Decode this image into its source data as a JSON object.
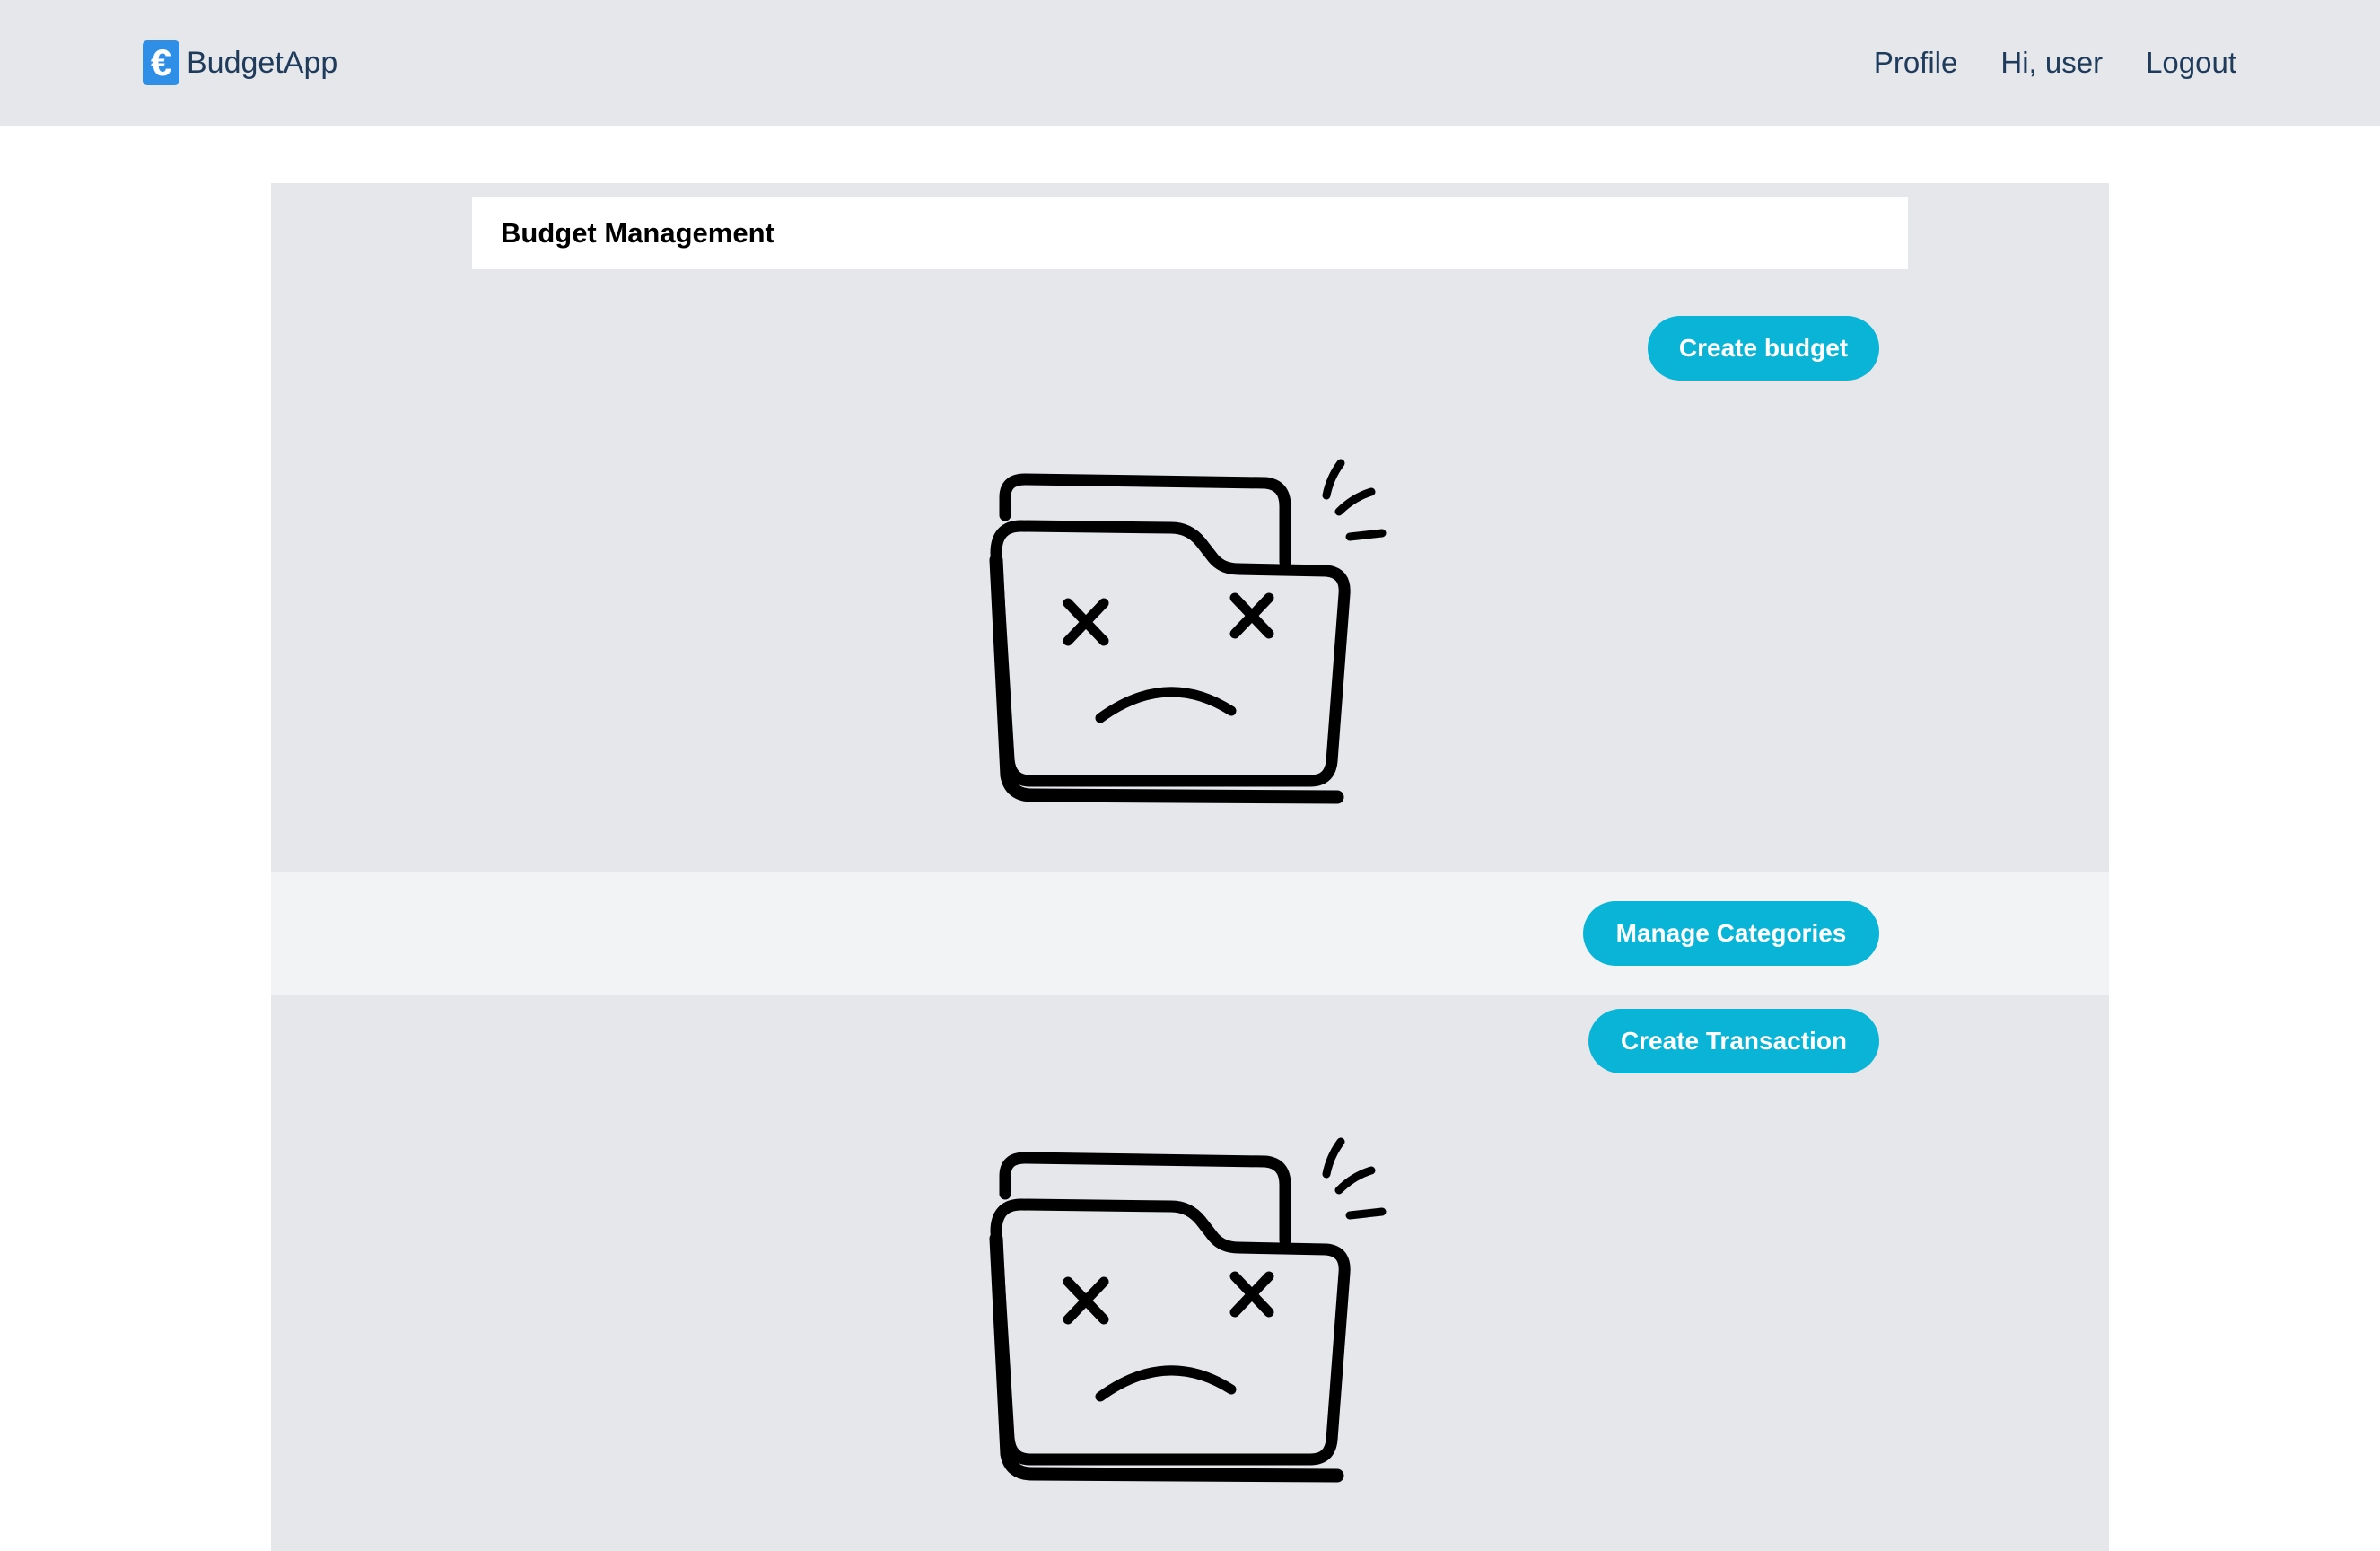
{
  "navbar": {
    "brand_icon": "€",
    "brand_name": "BudgetApp",
    "links": {
      "profile": "Profile",
      "greeting": "Hi, user",
      "logout": "Logout"
    }
  },
  "page": {
    "title": "Budget Management"
  },
  "budgets": {
    "create_label": "Create budget",
    "empty_icon": "sad-folder-icon"
  },
  "categories": {
    "manage_label": "Manage Categories"
  },
  "transactions": {
    "create_label": "Create Transaction",
    "empty_icon": "sad-folder-icon"
  },
  "colors": {
    "accent": "#0ab4d6",
    "navbar_bg": "#e5e7eb",
    "panel_bg": "#e5e7eb",
    "band_bg": "#f2f3f5",
    "nav_text": "#1f3b5c",
    "brand_icon_bg": "#2f8fe6"
  }
}
